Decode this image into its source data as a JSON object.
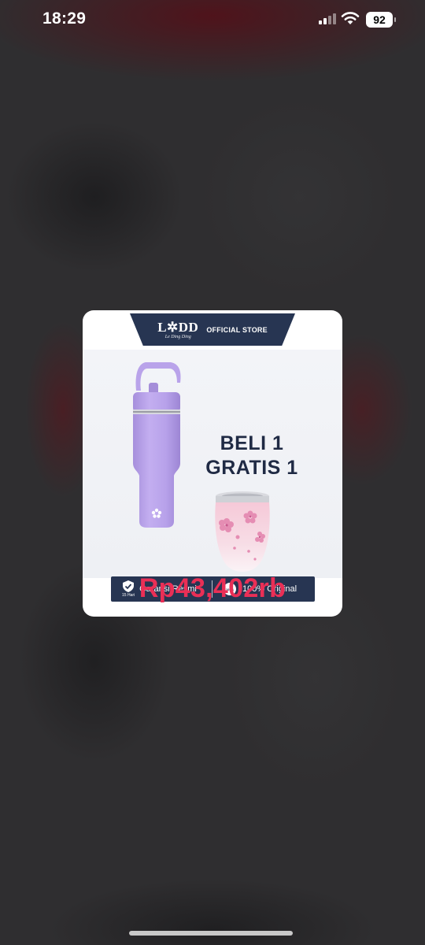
{
  "status_bar": {
    "time": "18:29",
    "battery_level": "92",
    "icons": [
      "signal-icon",
      "wifi-icon",
      "battery-icon"
    ]
  },
  "popup": {
    "store": {
      "logo_text": "L✲DD",
      "logo_subtext": "Le Ding Ding",
      "label": "OFFICIAL STORE"
    },
    "promo_line1": "BELI 1",
    "promo_line2": "GRATIS 1",
    "guarantee": {
      "left_label": "Garansi Resmi",
      "left_badge_sub": "15 Hari",
      "right_badge": "100%",
      "right_label": "100% Original"
    },
    "price": "Rp43,402rb"
  },
  "colors": {
    "navy": "#273552",
    "price_red": "#ea2f56",
    "tumbler_lavender": "#bca6ea",
    "cup_pink": "#f3c3d6"
  }
}
